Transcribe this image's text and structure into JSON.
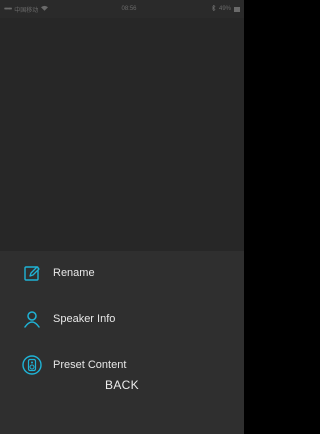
{
  "status_bar": {
    "signal": "•••••",
    "carrier": "中国移动",
    "time": "08:56",
    "battery": "49%"
  },
  "menu": {
    "items": [
      {
        "label": "Rename",
        "icon": "edit-icon"
      },
      {
        "label": "Speaker Info",
        "icon": "person-icon"
      },
      {
        "label": "Preset Content",
        "icon": "speaker-icon"
      }
    ],
    "back_label": "BACK"
  },
  "colors": {
    "accent": "#1fb3d6",
    "background": "#2a2a2a",
    "sheet": "#2f2f2f",
    "text": "#e8e8e8"
  }
}
